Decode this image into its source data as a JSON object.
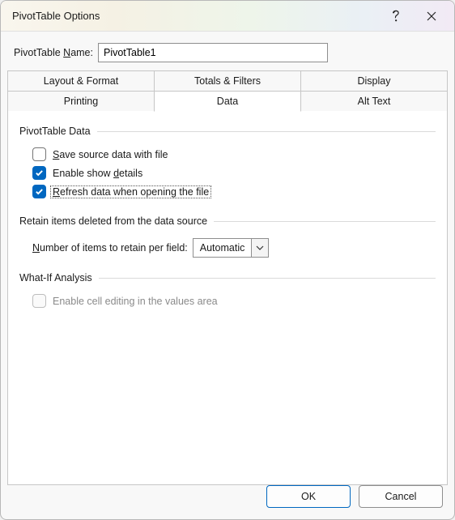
{
  "title": "PivotTable Options",
  "name_field": {
    "label_pre": "PivotTable ",
    "label_u": "N",
    "label_post": "ame:",
    "value": "PivotTable1"
  },
  "tabs": {
    "row1": [
      "Layout & Format",
      "Totals & Filters",
      "Display"
    ],
    "row2": [
      "Printing",
      "Data",
      "Alt Text"
    ],
    "active": "Data"
  },
  "groups": {
    "pivot_data": {
      "legend": "PivotTable Data",
      "save_source": {
        "u": "S",
        "rest": "ave source data with file",
        "checked": false
      },
      "show_details": {
        "pre": "Enable show ",
        "u": "d",
        "post": "etails",
        "checked": true
      },
      "refresh_open": {
        "u": "R",
        "rest": "efresh data when opening the file",
        "checked": true
      }
    },
    "retain": {
      "legend": "Retain items deleted from the data source",
      "num_items": {
        "u": "N",
        "rest": "umber of items to retain per field:",
        "value": "Automatic"
      }
    },
    "whatif": {
      "legend": "What-If Analysis",
      "enable_cell": {
        "label": "Enable cell editing in the values area",
        "checked": false,
        "disabled": true
      }
    }
  },
  "buttons": {
    "ok": "OK",
    "cancel": "Cancel"
  }
}
